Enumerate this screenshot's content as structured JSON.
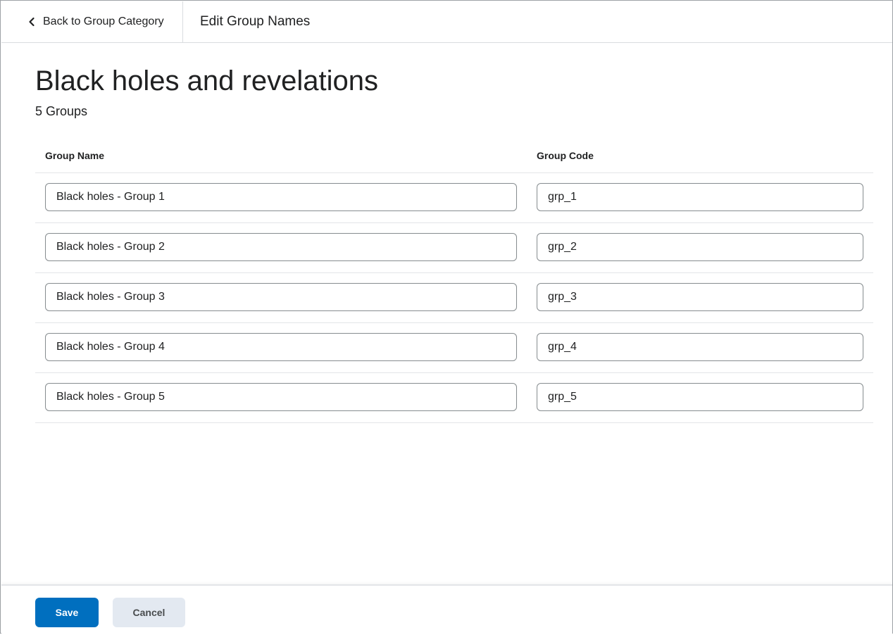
{
  "header": {
    "back_label": "Back to Group Category",
    "page_heading": "Edit Group Names"
  },
  "main": {
    "title": "Black holes and revelations",
    "group_count": "5 Groups",
    "columns": {
      "name": "Group Name",
      "code": "Group Code"
    },
    "rows": [
      {
        "name": "Black holes - Group 1",
        "code": "grp_1"
      },
      {
        "name": "Black holes - Group 2",
        "code": "grp_2"
      },
      {
        "name": "Black holes - Group 3",
        "code": "grp_3"
      },
      {
        "name": "Black holes - Group 4",
        "code": "grp_4"
      },
      {
        "name": "Black holes - Group 5",
        "code": "grp_5"
      }
    ]
  },
  "footer": {
    "save_label": "Save",
    "cancel_label": "Cancel"
  },
  "colors": {
    "primary": "#006fbf",
    "secondary_button": "#e3e9f1",
    "border": "#868c8f"
  },
  "icons": {
    "back": "chevron-left-icon"
  }
}
